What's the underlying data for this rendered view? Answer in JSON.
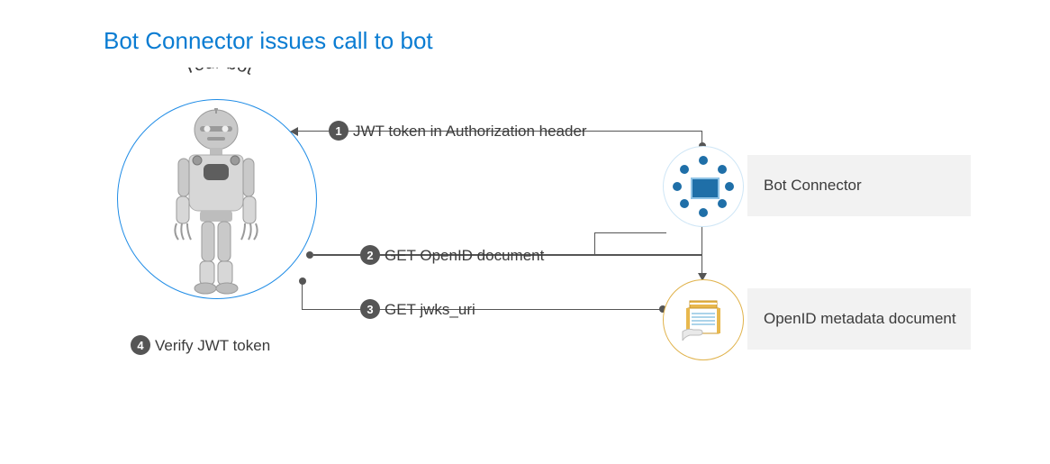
{
  "title": "Bot Connector issues call to bot",
  "bot_label": "Your bot",
  "steps": {
    "s1": {
      "num": "1",
      "text": "JWT token in Authorization header"
    },
    "s2": {
      "num": "2",
      "text": "GET OpenID document"
    },
    "s3": {
      "num": "3",
      "text": "GET jwks_uri"
    },
    "s4": {
      "num": "4",
      "text": "Verify JWT token"
    }
  },
  "nodes": {
    "connector": "Bot Connector",
    "openid": "OpenID metadata document"
  }
}
